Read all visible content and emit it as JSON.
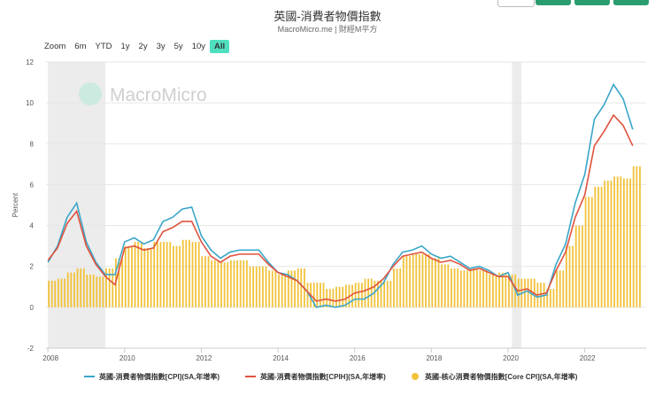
{
  "title": "英國-消費者物價指數",
  "subtitle": "MacroMicro.me | 財經M平方",
  "watermark": "MacroMicro",
  "range_selector": {
    "label": "Zoom",
    "options": [
      "6m",
      "YTD",
      "1y",
      "2y",
      "3y",
      "5y",
      "10y",
      "All"
    ],
    "selected": "All"
  },
  "chart_data": {
    "type": "line",
    "ylabel": "Percent",
    "ylim": [
      -2,
      12
    ],
    "yticks": [
      "-2",
      "0",
      "2",
      "4",
      "6",
      "8",
      "10",
      "12"
    ],
    "xlim": [
      2007.95,
      2023.6
    ],
    "xticks": [
      "2008",
      "2010",
      "2012",
      "2014",
      "2016",
      "2018",
      "2020",
      "2022"
    ],
    "recessions": [
      [
        2008.0,
        2009.5
      ],
      [
        2020.1,
        2020.35
      ]
    ],
    "x_start": 2008.0,
    "x_step": 0.25,
    "series": [
      {
        "name": "英國-消費者物價指數[CPI](SA,年增率)",
        "type": "line",
        "color": "#3aa6c9",
        "values": [
          2.2,
          3.0,
          4.4,
          5.1,
          3.2,
          2.2,
          1.6,
          1.6,
          3.2,
          3.4,
          3.1,
          3.3,
          4.2,
          4.4,
          4.8,
          4.9,
          3.5,
          2.8,
          2.4,
          2.7,
          2.8,
          2.8,
          2.8,
          2.2,
          1.7,
          1.6,
          1.3,
          0.8,
          0.0,
          0.1,
          0.0,
          0.1,
          0.4,
          0.4,
          0.7,
          1.2,
          2.1,
          2.7,
          2.8,
          3.0,
          2.6,
          2.4,
          2.5,
          2.2,
          1.9,
          2.0,
          1.8,
          1.5,
          1.7,
          0.6,
          0.8,
          0.5,
          0.6,
          2.1,
          3.1,
          5.1,
          6.5,
          9.2,
          9.9,
          10.9,
          10.2,
          8.7
        ]
      },
      {
        "name": "英國-消費者物價指數[CPIH](SA,年增率)",
        "type": "line",
        "color": "#e0523d",
        "values": [
          2.3,
          2.9,
          4.1,
          4.7,
          3.0,
          2.1,
          1.5,
          1.1,
          2.9,
          3.0,
          2.8,
          2.9,
          3.7,
          3.9,
          4.2,
          4.2,
          3.2,
          2.5,
          2.2,
          2.5,
          2.6,
          2.6,
          2.6,
          2.1,
          1.7,
          1.5,
          1.3,
          0.8,
          0.3,
          0.4,
          0.3,
          0.4,
          0.7,
          0.8,
          1.0,
          1.4,
          2.0,
          2.5,
          2.6,
          2.7,
          2.4,
          2.2,
          2.3,
          2.1,
          1.8,
          1.9,
          1.7,
          1.5,
          1.5,
          0.8,
          0.9,
          0.6,
          0.7,
          1.8,
          2.7,
          4.4,
          5.5,
          7.9,
          8.6,
          9.4,
          8.9,
          7.9
        ]
      },
      {
        "name": "英國-核心消費者物價指數[Core CPI](SA,年增率)",
        "type": "bar",
        "color": "#f2c23a",
        "values": [
          1.3,
          1.4,
          1.7,
          1.9,
          1.6,
          1.5,
          1.9,
          2.4,
          3.0,
          3.2,
          2.9,
          3.2,
          3.2,
          3.0,
          3.3,
          3.2,
          2.5,
          2.3,
          2.2,
          2.3,
          2.3,
          2.0,
          2.0,
          1.8,
          1.6,
          1.8,
          1.9,
          1.2,
          1.2,
          0.9,
          1.0,
          1.1,
          1.2,
          1.4,
          1.3,
          1.3,
          1.9,
          2.5,
          2.6,
          2.6,
          2.4,
          2.1,
          1.9,
          1.8,
          1.9,
          1.8,
          1.6,
          1.7,
          1.6,
          1.4,
          1.4,
          1.2,
          0.9,
          1.8,
          3.0,
          4.0,
          5.4,
          5.9,
          6.2,
          6.4,
          6.3,
          6.9
        ]
      }
    ]
  }
}
